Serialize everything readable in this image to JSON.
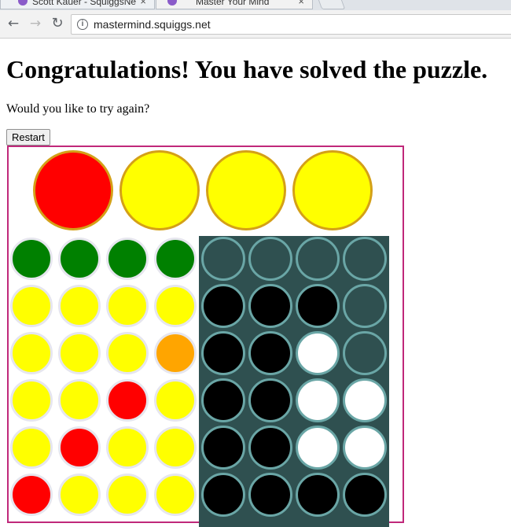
{
  "browser": {
    "tabs": [
      {
        "title": "Scott Kauer - SquiggsNe",
        "active": false
      },
      {
        "title": "Master Your Mind",
        "active": true
      }
    ],
    "url": "mastermind.squiggs.net",
    "icons": {
      "back": "back-arrow-icon",
      "forward": "forward-arrow-icon",
      "reload": "reload-icon",
      "info": "info-icon"
    }
  },
  "page": {
    "title": "Congratulations! You have solved the puzzle.",
    "prompt": "Would you like to try again?",
    "restart_label": "Restart"
  },
  "colors": {
    "red": "#ff0000",
    "yellow": "#ffff00",
    "green": "#008000",
    "orange": "#ffa500",
    "black": "#000000",
    "white": "#ffffff",
    "empty": "#2f5050",
    "board_border": "#c0287a",
    "secret_border": "#d4a017"
  },
  "game": {
    "secret": [
      "red",
      "yellow",
      "yellow",
      "yellow"
    ],
    "rows": [
      {
        "guess": [
          "green",
          "green",
          "green",
          "green"
        ],
        "feedback": [
          "empty",
          "empty",
          "empty",
          "empty"
        ]
      },
      {
        "guess": [
          "yellow",
          "yellow",
          "yellow",
          "yellow"
        ],
        "feedback": [
          "black",
          "black",
          "black",
          "empty"
        ]
      },
      {
        "guess": [
          "yellow",
          "yellow",
          "yellow",
          "orange"
        ],
        "feedback": [
          "black",
          "black",
          "white",
          "empty"
        ]
      },
      {
        "guess": [
          "yellow",
          "yellow",
          "red",
          "yellow"
        ],
        "feedback": [
          "black",
          "black",
          "white",
          "white"
        ]
      },
      {
        "guess": [
          "yellow",
          "red",
          "yellow",
          "yellow"
        ],
        "feedback": [
          "black",
          "black",
          "white",
          "white"
        ]
      },
      {
        "guess": [
          "red",
          "yellow",
          "yellow",
          "yellow"
        ],
        "feedback": [
          "black",
          "black",
          "black",
          "black"
        ]
      }
    ]
  }
}
